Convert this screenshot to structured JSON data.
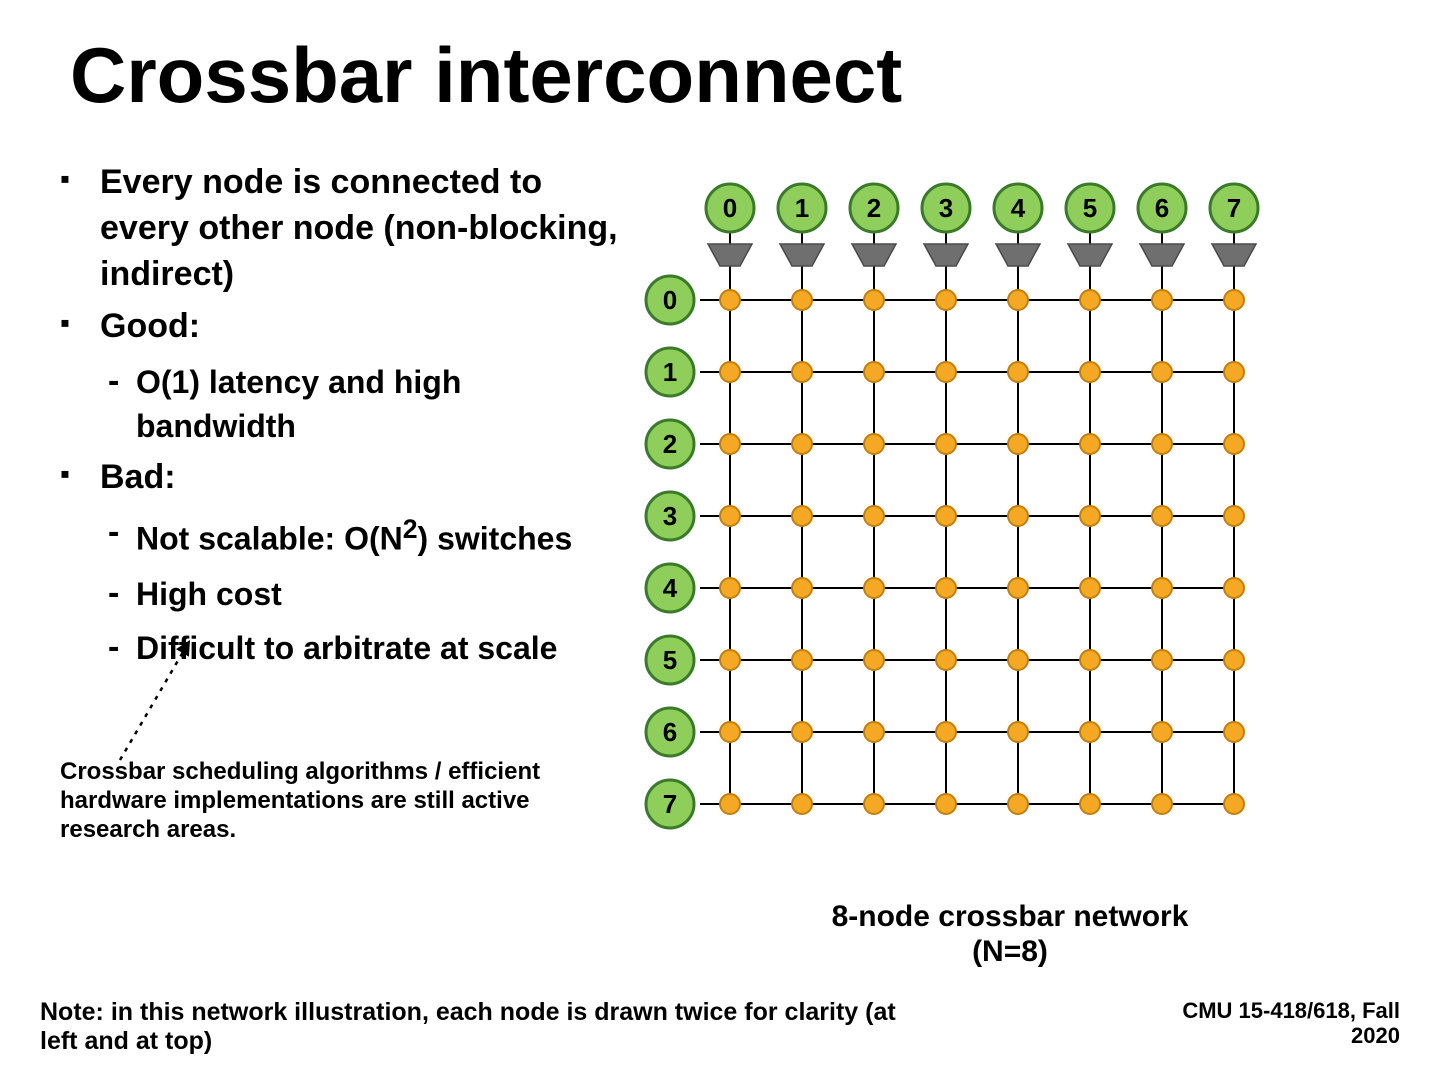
{
  "title": "Crossbar interconnect",
  "bullets": {
    "b1": "Every node is connected to every other node (non-blocking, indirect)",
    "b2": "Good:",
    "b2_sub1": "O(1) latency and high bandwidth",
    "b3": "Bad:",
    "b3_sub1_pre": "Not scalable: O(N",
    "b3_sub1_sup": "2",
    "b3_sub1_post": ") switches",
    "b3_sub2": "High cost",
    "b3_sub3": "Difficult to arbitrate at scale"
  },
  "annotation": "Crossbar scheduling algorithms / efficient hardware implementations are still active research areas.",
  "caption_line1": "8-node crossbar network",
  "caption_line2": "(N=8)",
  "note": "Note: in this network illustration, each node is drawn twice for clarity (at left and at top)",
  "course_line1": "CMU 15-418/618, Fall",
  "course_line2": "2020",
  "diagram": {
    "top_nodes": [
      "0",
      "1",
      "2",
      "3",
      "4",
      "5",
      "6",
      "7"
    ],
    "left_nodes": [
      "0",
      "1",
      "2",
      "3",
      "4",
      "5",
      "6",
      "7"
    ],
    "colors": {
      "node_fill": "#8fce5a",
      "node_stroke": "#3a7a2a",
      "switch_fill": "#f4a823",
      "switch_stroke": "#c27f0e",
      "trapezoid_fill": "#6f6f6f",
      "trapezoid_stroke": "#4a4a4a",
      "wire": "#000000"
    }
  }
}
